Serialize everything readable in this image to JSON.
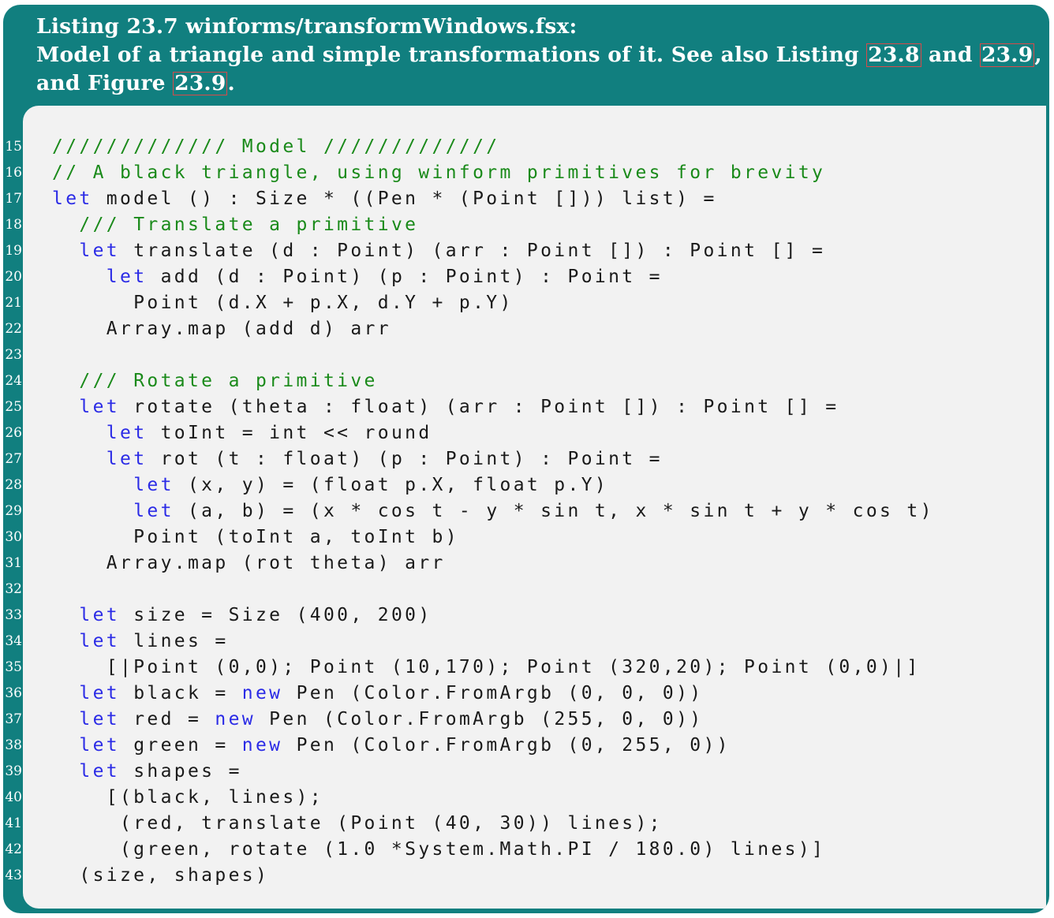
{
  "caption": {
    "line1": "Listing 23.7 winforms/transformWindows.fsx:",
    "line2_text": "Model of a triangle and simple transformations of it. See also Listing ",
    "line2_ref1": "23.8",
    "line2_mid": " and ",
    "line2_ref2": "23.9",
    "line2_end": ",",
    "line3_text": "and Figure ",
    "line3_ref": "23.9",
    "line3_end": "."
  },
  "colors": {
    "frame": "#117f7f",
    "code_background": "#f2f2f2",
    "keyword": "#2b2be6",
    "comment": "#1a8a1a",
    "reference_box": "#d84a4a"
  },
  "code_lines": [
    {
      "n": "15",
      "tokens": [
        {
          "t": "///////////// Model /////////////",
          "c": "cm"
        }
      ]
    },
    {
      "n": "16",
      "tokens": [
        {
          "t": "// A black triangle, using winform primitives for brevity",
          "c": "cm"
        }
      ]
    },
    {
      "n": "17",
      "tokens": [
        {
          "t": "let",
          "c": "kw"
        },
        {
          "t": " model () : Size * ((Pen * (Point [])) list) =",
          "c": "bl"
        }
      ]
    },
    {
      "n": "18",
      "tokens": [
        {
          "t": "  ",
          "c": "bl"
        },
        {
          "t": "/// Translate a primitive",
          "c": "cm"
        }
      ]
    },
    {
      "n": "19",
      "tokens": [
        {
          "t": "  ",
          "c": "bl"
        },
        {
          "t": "let",
          "c": "kw"
        },
        {
          "t": " translate (d : Point) (arr : Point []) : Point [] =",
          "c": "bl"
        }
      ]
    },
    {
      "n": "20",
      "tokens": [
        {
          "t": "    ",
          "c": "bl"
        },
        {
          "t": "let",
          "c": "kw"
        },
        {
          "t": " add (d : Point) (p : Point) : Point =",
          "c": "bl"
        }
      ]
    },
    {
      "n": "21",
      "tokens": [
        {
          "t": "      Point (d.X + p.X, d.Y + p.Y)",
          "c": "bl"
        }
      ]
    },
    {
      "n": "22",
      "tokens": [
        {
          "t": "    Array.map (add d) arr",
          "c": "bl"
        }
      ]
    },
    {
      "n": "23",
      "tokens": [
        {
          "t": "",
          "c": "bl"
        }
      ]
    },
    {
      "n": "24",
      "tokens": [
        {
          "t": "  ",
          "c": "bl"
        },
        {
          "t": "/// Rotate a primitive",
          "c": "cm"
        }
      ]
    },
    {
      "n": "25",
      "tokens": [
        {
          "t": "  ",
          "c": "bl"
        },
        {
          "t": "let",
          "c": "kw"
        },
        {
          "t": " rotate (theta : float) (arr : Point []) : Point [] =",
          "c": "bl"
        }
      ]
    },
    {
      "n": "26",
      "tokens": [
        {
          "t": "    ",
          "c": "bl"
        },
        {
          "t": "let",
          "c": "kw"
        },
        {
          "t": " toInt = int << round",
          "c": "bl"
        }
      ]
    },
    {
      "n": "27",
      "tokens": [
        {
          "t": "    ",
          "c": "bl"
        },
        {
          "t": "let",
          "c": "kw"
        },
        {
          "t": " rot (t : float) (p : Point) : Point =",
          "c": "bl"
        }
      ]
    },
    {
      "n": "28",
      "tokens": [
        {
          "t": "      ",
          "c": "bl"
        },
        {
          "t": "let",
          "c": "kw"
        },
        {
          "t": " (x, y) = (float p.X, float p.Y)",
          "c": "bl"
        }
      ]
    },
    {
      "n": "29",
      "tokens": [
        {
          "t": "      ",
          "c": "bl"
        },
        {
          "t": "let",
          "c": "kw"
        },
        {
          "t": " (a, b) = (x * cos t - y * sin t, x * sin t + y * cos t)",
          "c": "bl"
        }
      ]
    },
    {
      "n": "30",
      "tokens": [
        {
          "t": "      Point (toInt a, toInt b)",
          "c": "bl"
        }
      ]
    },
    {
      "n": "31",
      "tokens": [
        {
          "t": "    Array.map (rot theta) arr",
          "c": "bl"
        }
      ]
    },
    {
      "n": "32",
      "tokens": [
        {
          "t": "",
          "c": "bl"
        }
      ]
    },
    {
      "n": "33",
      "tokens": [
        {
          "t": "  ",
          "c": "bl"
        },
        {
          "t": "let",
          "c": "kw"
        },
        {
          "t": " size = Size (400, 200)",
          "c": "bl"
        }
      ]
    },
    {
      "n": "34",
      "tokens": [
        {
          "t": "  ",
          "c": "bl"
        },
        {
          "t": "let",
          "c": "kw"
        },
        {
          "t": " lines =",
          "c": "bl"
        }
      ]
    },
    {
      "n": "35",
      "tokens": [
        {
          "t": "    [|Point (0,0); Point (10,170); Point (320,20); Point (0,0)|]",
          "c": "bl"
        }
      ]
    },
    {
      "n": "36",
      "tokens": [
        {
          "t": "  ",
          "c": "bl"
        },
        {
          "t": "let",
          "c": "kw"
        },
        {
          "t": " black = ",
          "c": "bl"
        },
        {
          "t": "new",
          "c": "kw"
        },
        {
          "t": " Pen (Color.FromArgb (0, 0, 0))",
          "c": "bl"
        }
      ]
    },
    {
      "n": "37",
      "tokens": [
        {
          "t": "  ",
          "c": "bl"
        },
        {
          "t": "let",
          "c": "kw"
        },
        {
          "t": " red = ",
          "c": "bl"
        },
        {
          "t": "new",
          "c": "kw"
        },
        {
          "t": " Pen (Color.FromArgb (255, 0, 0))",
          "c": "bl"
        }
      ]
    },
    {
      "n": "38",
      "tokens": [
        {
          "t": "  ",
          "c": "bl"
        },
        {
          "t": "let",
          "c": "kw"
        },
        {
          "t": " green = ",
          "c": "bl"
        },
        {
          "t": "new",
          "c": "kw"
        },
        {
          "t": " Pen (Color.FromArgb (0, 255, 0))",
          "c": "bl"
        }
      ]
    },
    {
      "n": "39",
      "tokens": [
        {
          "t": "  ",
          "c": "bl"
        },
        {
          "t": "let",
          "c": "kw"
        },
        {
          "t": " shapes =",
          "c": "bl"
        }
      ]
    },
    {
      "n": "40",
      "tokens": [
        {
          "t": "    [(black, lines);",
          "c": "bl"
        }
      ]
    },
    {
      "n": "41",
      "tokens": [
        {
          "t": "     (red, translate (Point (40, 30)) lines);",
          "c": "bl"
        }
      ]
    },
    {
      "n": "42",
      "tokens": [
        {
          "t": "     (green, rotate (1.0 *System.Math.PI / 180.0) lines)]",
          "c": "bl"
        }
      ]
    },
    {
      "n": "43",
      "tokens": [
        {
          "t": "  (size, shapes)",
          "c": "bl"
        }
      ]
    }
  ]
}
